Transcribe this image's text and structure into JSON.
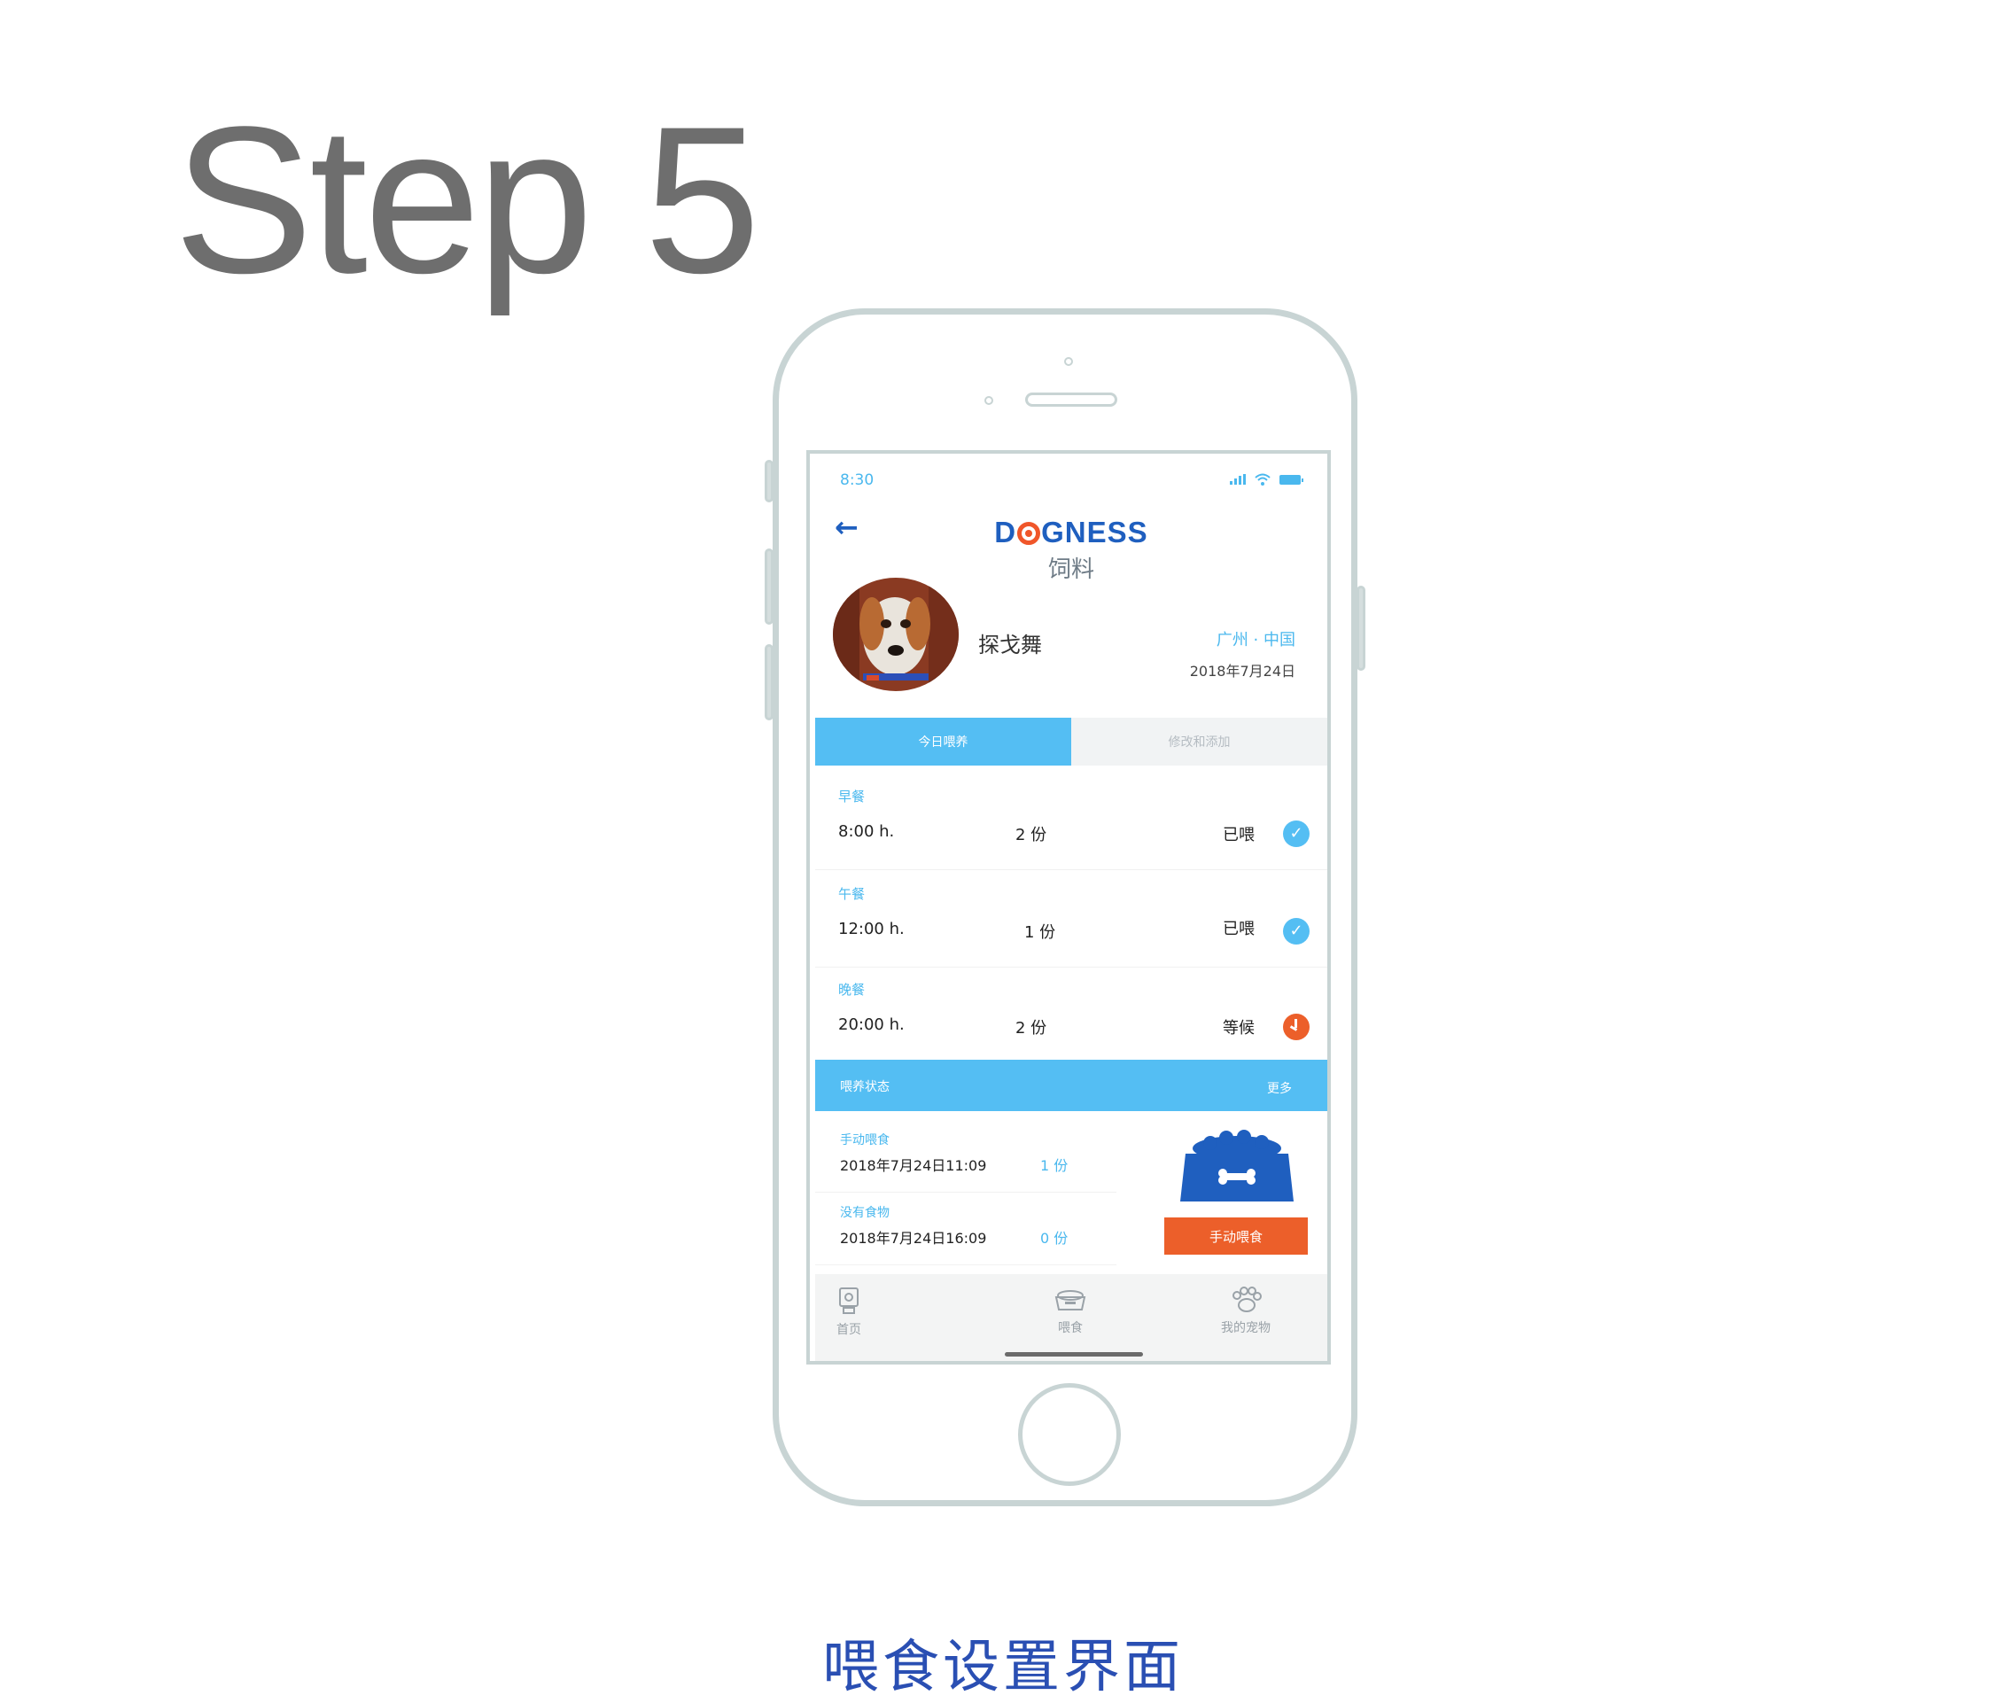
{
  "step_title": "Step 5",
  "caption": "喂食设置界面",
  "status_bar": {
    "time": "8:30"
  },
  "header": {
    "logo_left": "D",
    "logo_right": "GNESS",
    "subtitle": "饲料"
  },
  "profile": {
    "pet_name": "探戈舞",
    "location": "广州 · 中国",
    "date": "2018年7月24日"
  },
  "tabs": [
    {
      "label": "今日喂养",
      "active": true
    },
    {
      "label": "修改和添加",
      "active": false
    }
  ],
  "meals": [
    {
      "label": "早餐",
      "time": "8:00 h.",
      "portion": "2 份",
      "status": "已喂",
      "state": "done"
    },
    {
      "label": "午餐",
      "time": "12:00 h.",
      "portion": "1 份",
      "status": "已喂",
      "state": "done"
    },
    {
      "label": "晚餐",
      "time": "20:00 h.",
      "portion": "2 份",
      "status": "等候",
      "state": "waiting"
    }
  ],
  "feeding_status": {
    "title": "喂养状态",
    "more": "更多",
    "logs": [
      {
        "type": "手动喂食",
        "time": "2018年7月24日11:09",
        "portion": "1 份"
      },
      {
        "type": "没有食物",
        "time": "2018年7月24日16:09",
        "portion": "0 份"
      }
    ],
    "manual_button": "手动喂食"
  },
  "bottom_nav": [
    {
      "label": "首页",
      "icon": "camera-icon"
    },
    {
      "label": "喂食",
      "icon": "food-bowl-icon"
    },
    {
      "label": "我的宠物",
      "icon": "paw-icon"
    }
  ],
  "colors": {
    "accent_blue": "#54bef3",
    "brand_blue": "#1f5fbf",
    "orange": "#ec5f2a",
    "caption_blue": "#2a4fb3"
  }
}
